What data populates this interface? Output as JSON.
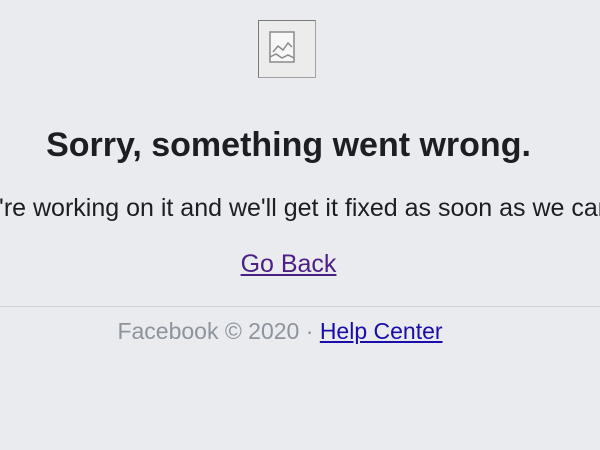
{
  "error": {
    "image_icon": "broken-image-icon",
    "title": "Sorry, something went wrong.",
    "message": "We're working on it and we'll get it fixed as soon as we can.",
    "go_back": "Go Back"
  },
  "footer": {
    "copyright": "Facebook © 2020",
    "separator": "·",
    "help_center": "Help Center"
  },
  "colors": {
    "background": "#e9ebee",
    "text": "#1c1e21",
    "visited_link": "#4b1f85",
    "link": "#1a0dab",
    "muted": "#8d949e"
  }
}
